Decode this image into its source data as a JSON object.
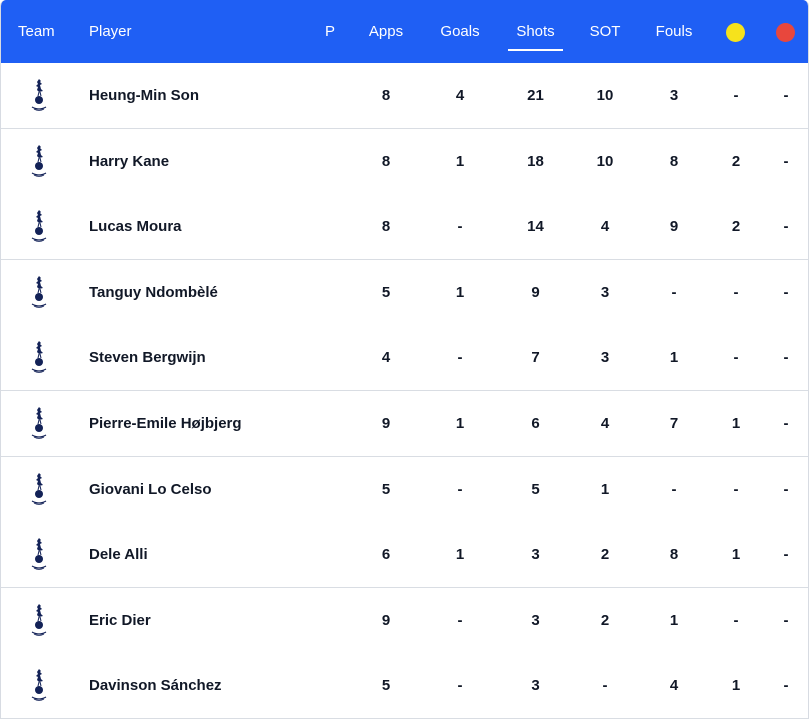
{
  "header": {
    "team": "Team",
    "player": "Player",
    "p": "P",
    "apps": "Apps",
    "goals": "Goals",
    "shots": "Shots",
    "sot": "SOT",
    "fouls": "Fouls",
    "yellow_icon": "yellow-card",
    "red_icon": "red-card",
    "active_sort": "shots"
  },
  "colors": {
    "header_bg": "#1f5ff4",
    "yellow": "#f6e21c",
    "red": "#e8473d",
    "crest": "#132257"
  },
  "rows": [
    {
      "player": "Heung-Min Son",
      "apps": "8",
      "goals": "4",
      "shots": "21",
      "sot": "10",
      "fouls": "3",
      "yellow": "-",
      "red": "-"
    },
    {
      "player": "Harry Kane",
      "apps": "8",
      "goals": "1",
      "shots": "18",
      "sot": "10",
      "fouls": "8",
      "yellow": "2",
      "red": "-"
    },
    {
      "player": "Lucas Moura",
      "apps": "8",
      "goals": "-",
      "shots": "14",
      "sot": "4",
      "fouls": "9",
      "yellow": "2",
      "red": "-"
    },
    {
      "player": "Tanguy Ndombèlé",
      "apps": "5",
      "goals": "1",
      "shots": "9",
      "sot": "3",
      "fouls": "-",
      "yellow": "-",
      "red": "-"
    },
    {
      "player": "Steven Bergwijn",
      "apps": "4",
      "goals": "-",
      "shots": "7",
      "sot": "3",
      "fouls": "1",
      "yellow": "-",
      "red": "-"
    },
    {
      "player": "Pierre-Emile Højbjerg",
      "apps": "9",
      "goals": "1",
      "shots": "6",
      "sot": "4",
      "fouls": "7",
      "yellow": "1",
      "red": "-"
    },
    {
      "player": "Giovani Lo Celso",
      "apps": "5",
      "goals": "-",
      "shots": "5",
      "sot": "1",
      "fouls": "-",
      "yellow": "-",
      "red": "-"
    },
    {
      "player": "Dele Alli",
      "apps": "6",
      "goals": "1",
      "shots": "3",
      "sot": "2",
      "fouls": "8",
      "yellow": "1",
      "red": "-"
    },
    {
      "player": "Eric Dier",
      "apps": "9",
      "goals": "-",
      "shots": "3",
      "sot": "2",
      "fouls": "1",
      "yellow": "-",
      "red": "-"
    },
    {
      "player": "Davinson Sánchez",
      "apps": "5",
      "goals": "-",
      "shots": "3",
      "sot": "-",
      "fouls": "4",
      "yellow": "1",
      "red": "-"
    }
  ]
}
